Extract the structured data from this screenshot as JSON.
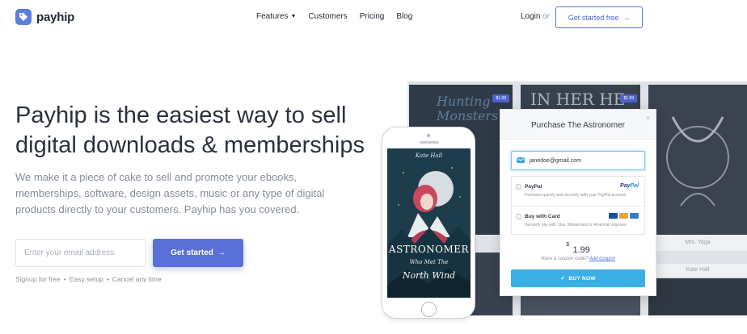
{
  "header": {
    "brand": "payhip",
    "nav": [
      {
        "label": "Features",
        "has_dropdown": true
      },
      {
        "label": "Customers"
      },
      {
        "label": "Pricing"
      },
      {
        "label": "Blog"
      }
    ],
    "login": "Login",
    "or": "or",
    "get_started_free": "Get started free"
  },
  "hero": {
    "title_line1": "Payhip is the easiest way to sell",
    "title_line2": "digital downloads & memberships",
    "subtitle": "We make it a piece of cake to sell and promote your ebooks, memberships, software, design assets, music or any type of digital products directly to your customers. Payhip has you covered.",
    "email_placeholder": "Enter your email address",
    "cta": "Get started",
    "perks": [
      "Signup for free",
      "Easy setup",
      "Cancel any time"
    ],
    "perk_separator": "•"
  },
  "showcase": {
    "bg_books": [
      {
        "script": "Hunting Monsters",
        "price": "$1.99"
      },
      {
        "script": "IN HER HE",
        "price": "$1.99"
      },
      {
        "script": "",
        "price": ""
      },
      {
        "script": "",
        "price": ""
      }
    ],
    "bg_captions": [
      "Mrs. Yaga",
      "Kate Hall"
    ],
    "phone_cover": {
      "author": "Kate Hall",
      "title": "ASTRONOMER",
      "subtitle": "Who Met The",
      "subtitle2": "North Wind"
    }
  },
  "checkout": {
    "title": "Purchase The Astronomer",
    "close": "×",
    "email_value": "janedoe@gmail.com",
    "paypal_name": "PayPal",
    "paypal_desc": "Purchase quickly and securely with your PayPal account",
    "paypal_logo_a": "Pay",
    "paypal_logo_b": "Pal",
    "card_name": "Buy with Card",
    "card_desc": "Securely pay with Visa, Mastercard or American Express",
    "currency": "$",
    "price": "1.99",
    "coupon_text": "Have a coupon code?",
    "coupon_link": "Add coupon",
    "buy_now": "BUY NOW"
  },
  "colors": {
    "accent": "#5a6fd8",
    "buy_button": "#3cb0e6",
    "text_dark": "#2a313c",
    "text_muted": "#858d98"
  }
}
